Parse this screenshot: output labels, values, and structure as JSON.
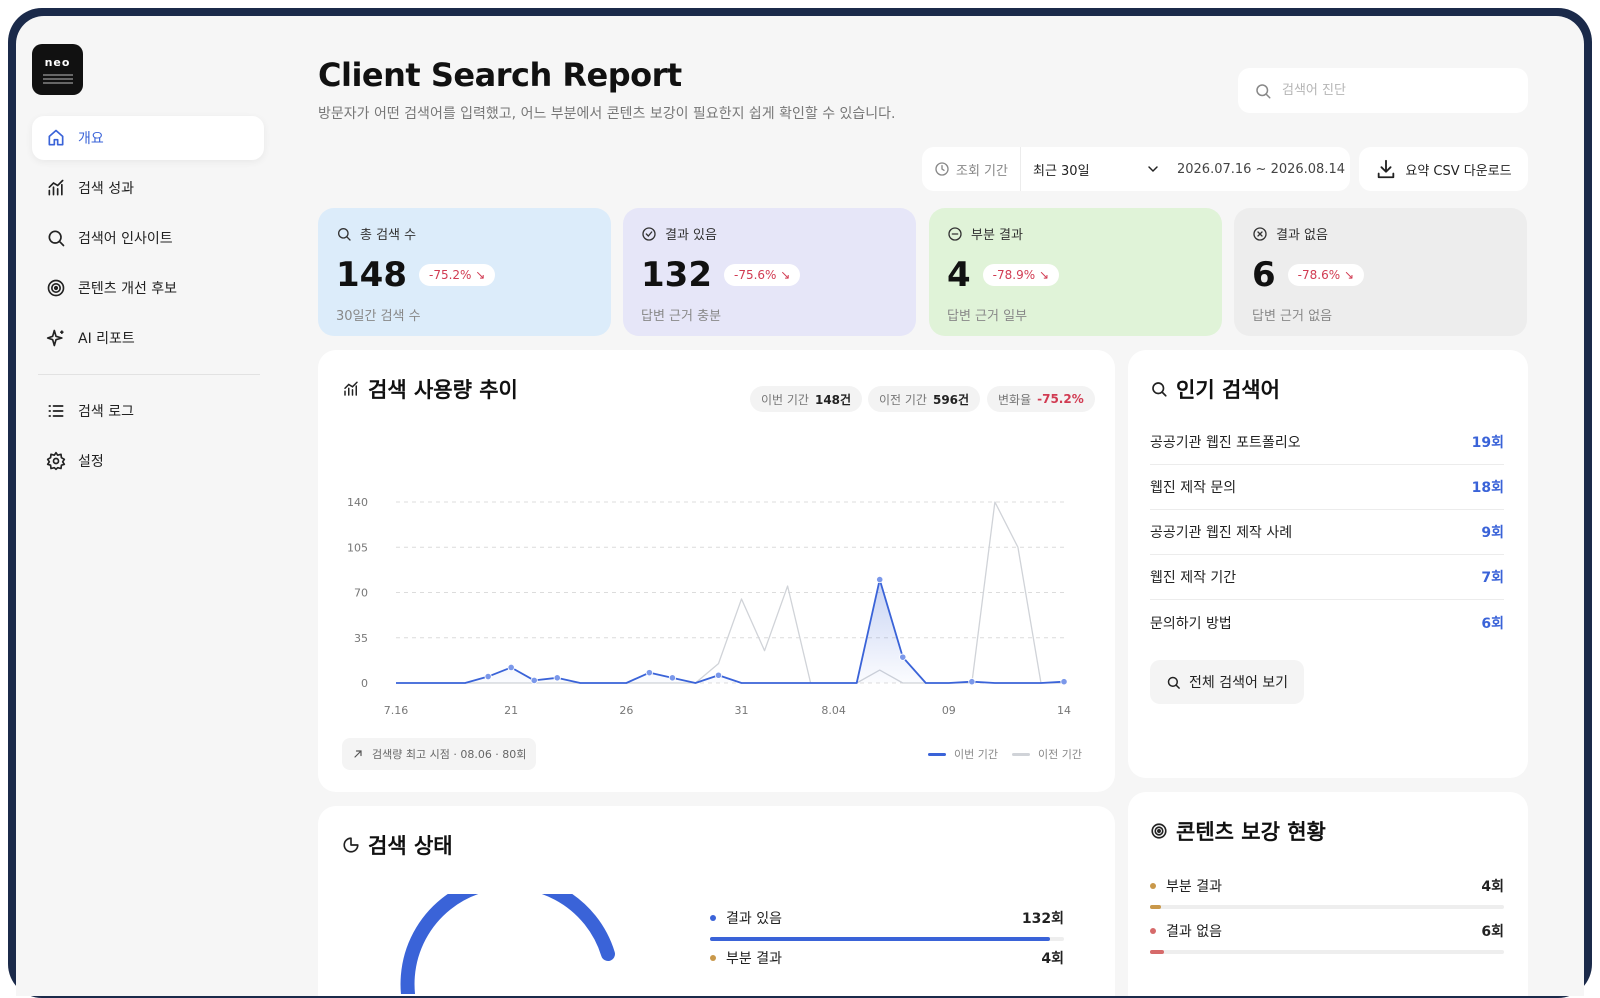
{
  "app": {
    "logo_text": "neo"
  },
  "sidebar": {
    "items": [
      {
        "label": "개요",
        "icon": "home-icon",
        "active": true
      },
      {
        "label": "검색 성과",
        "icon": "chart-icon"
      },
      {
        "label": "검색어 인사이트",
        "icon": "search-icon"
      },
      {
        "label": "콘텐츠 개선 후보",
        "icon": "target-icon"
      },
      {
        "label": "AI 리포트",
        "icon": "sparkle-icon"
      }
    ],
    "bottom_items": [
      {
        "label": "검색 로그",
        "icon": "list-icon"
      },
      {
        "label": "설정",
        "icon": "gear-icon"
      }
    ]
  },
  "header": {
    "title": "Client Search Report",
    "subtitle": "방문자가 어떤 검색어를 입력했고, 어느 부분에서 콘텐츠 보강이 필요한지 쉽게 확인할 수 있습니다.",
    "search_placeholder": "검색어 진단"
  },
  "period": {
    "label": "조회 기간",
    "selected": "최근 30일",
    "range": "2026.07.16 ~ 2026.08.14",
    "csv_label": "요약 CSV 다운로드"
  },
  "stats": [
    {
      "label": "총 검색 수",
      "value": "148",
      "change": "-75.2%",
      "desc": "30일간 검색 수",
      "bg": "#dcecfa"
    },
    {
      "label": "결과 있음",
      "value": "132",
      "change": "-75.6%",
      "desc": "답변 근거 충분",
      "bg": "#e6e6f8"
    },
    {
      "label": "부분 결과",
      "value": "4",
      "change": "-78.9%",
      "desc": "답변 근거 일부",
      "bg": "#e0f3d8"
    },
    {
      "label": "결과 없음",
      "value": "6",
      "change": "-78.6%",
      "desc": "답변 근거 없음",
      "bg": "#ededed"
    }
  ],
  "usage": {
    "title": "검색 사용량 추이",
    "pills": [
      {
        "label": "이번 기간",
        "value": "148건"
      },
      {
        "label": "이전 기간",
        "value": "596건"
      },
      {
        "label": "변화율",
        "value": "-75.2%"
      }
    ],
    "peak": "검색량 최고 시점 · 08.06 · 80회",
    "legend_current": "이번 기간",
    "legend_previous": "이전 기간"
  },
  "chart_data": {
    "type": "line",
    "x": [
      "7.16",
      "7.17",
      "7.18",
      "7.19",
      "7.20",
      "7.21",
      "7.22",
      "7.23",
      "7.24",
      "7.25",
      "7.26",
      "7.27",
      "7.28",
      "7.29",
      "7.30",
      "7.31",
      "8.01",
      "8.02",
      "8.03",
      "8.04",
      "8.05",
      "8.06",
      "8.07",
      "8.08",
      "8.09",
      "8.10",
      "8.11",
      "8.12",
      "8.13",
      "8.14"
    ],
    "x_tick_labels": [
      "7.16",
      "21",
      "26",
      "31",
      "8.04",
      "09",
      "14"
    ],
    "x_tick_index": [
      0,
      5,
      10,
      15,
      19,
      24,
      29
    ],
    "y_ticks": [
      0,
      35,
      70,
      105,
      140
    ],
    "ylim": [
      0,
      140
    ],
    "grid": true,
    "legend": "bottom-right",
    "series": [
      {
        "name": "이번 기간",
        "color": "#3a63d8",
        "values": [
          0,
          0,
          0,
          0,
          5,
          12,
          2,
          4,
          0,
          0,
          0,
          8,
          4,
          0,
          6,
          0,
          0,
          0,
          0,
          0,
          0,
          80,
          20,
          0,
          0,
          1,
          0,
          0,
          0,
          1
        ]
      },
      {
        "name": "이전 기간",
        "color": "#d0d3d8",
        "values": [
          0,
          0,
          0,
          0,
          0,
          0,
          0,
          0,
          0,
          0,
          0,
          0,
          0,
          0,
          15,
          65,
          25,
          75,
          0,
          0,
          0,
          10,
          0,
          0,
          0,
          0,
          140,
          105,
          0,
          0
        ]
      }
    ],
    "current_markers": [
      4,
      5,
      6,
      7,
      11,
      12,
      14,
      21,
      22,
      25,
      29
    ]
  },
  "popular": {
    "title": "인기 검색어",
    "items": [
      {
        "keyword": "공공기관 웹진 포트폴리오",
        "count": "19회"
      },
      {
        "keyword": "웹진 제작 문의",
        "count": "18회"
      },
      {
        "keyword": "공공기관 웹진 제작 사례",
        "count": "9회"
      },
      {
        "keyword": "웹진 제작 기간",
        "count": "7회"
      },
      {
        "keyword": "문의하기 방법",
        "count": "6회"
      }
    ],
    "view_all": "전체 검색어 보기"
  },
  "status": {
    "title": "검색 상태",
    "items": [
      {
        "label": "결과 있음",
        "count": "132회",
        "fraction": 0.89,
        "color": "#3a63d8"
      },
      {
        "label": "부분 결과",
        "count": "4회",
        "fraction": 0.03,
        "color": "#c9984a"
      }
    ]
  },
  "content": {
    "title": "콘텐츠 보강 현황",
    "items": [
      {
        "label": "부분 결과",
        "count": "4회",
        "fraction": 0.03,
        "color": "#c9984a"
      },
      {
        "label": "결과 없음",
        "count": "6회",
        "fraction": 0.04,
        "color": "#d66a6a"
      }
    ]
  }
}
